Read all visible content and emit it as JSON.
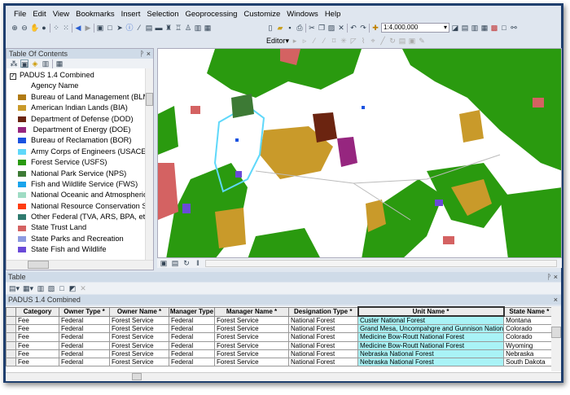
{
  "menu": [
    "File",
    "Edit",
    "View",
    "Bookmarks",
    "Insert",
    "Selection",
    "Geoprocessing",
    "Customize",
    "Windows",
    "Help"
  ],
  "toolbar": {
    "scale": "1:4,000,000",
    "editor": "Editor▾"
  },
  "toc": {
    "title": "Table Of Contents",
    "layer": "PADUS 1.4 Combined",
    "field": "Agency Name",
    "items": [
      {
        "label": "Bureau of Land Management (BLM)",
        "color": "#b07a14"
      },
      {
        "label": "American Indian Lands (BIA)",
        "color": "#c99a2a"
      },
      {
        "label": "Department of Defense (DOD)",
        "color": "#6b2410"
      },
      {
        "label": " Department of Energy (DOE)",
        "color": "#96267f"
      },
      {
        "label": "Bureau of Reclamation (BOR)",
        "color": "#1a52e0"
      },
      {
        "label": "Army Corps of Engineers (USACE)",
        "color": "#5fd8fa"
      },
      {
        "label": "Forest Service (USFS)",
        "color": "#2a9a0f"
      },
      {
        "label": "National Park Service (NPS)",
        "color": "#3d7a35"
      },
      {
        "label": "Fish and Wildlife Service (FWS)",
        "color": "#1aa4ec"
      },
      {
        "label": "National Oceanic and Atmospheric Ac",
        "color": "#9fdcc4"
      },
      {
        "label": "National Resource Conservation Servic",
        "color": "#ff3c0f"
      },
      {
        "label": "Other Federal (TVA, ARS, BPA, etc.)",
        "color": "#2f7a6e"
      },
      {
        "label": "State Trust Land",
        "color": "#d46262"
      },
      {
        "label": "State Parks and Recreation",
        "color": "#8c9ae0"
      },
      {
        "label": "State Fish and Wildlife",
        "color": "#6a4ad8"
      }
    ]
  },
  "table": {
    "panel_title": "Table",
    "title": "PADUS 1.4 Combined",
    "columns": [
      "Category",
      "Owner Type *",
      "Owner Name *",
      "Manager Type",
      "Manager Name *",
      "Designation Type *",
      "Unit Name *",
      "State Name *"
    ],
    "rows": [
      [
        "Fee",
        "Federal",
        "Forest Service",
        "Federal",
        "Forest Service",
        "National Forest",
        "Custer National Forest",
        "Montana"
      ],
      [
        "Fee",
        "Federal",
        "Forest Service",
        "Federal",
        "Forest Service",
        "National Forest",
        "Grand Mesa, Uncompahgre and Gunnison Nation",
        "Colorado"
      ],
      [
        "Fee",
        "Federal",
        "Forest Service",
        "Federal",
        "Forest Service",
        "National Forest",
        "Medicine Bow-Routt National Forest",
        "Colorado"
      ],
      [
        "Fee",
        "Federal",
        "Forest Service",
        "Federal",
        "Forest Service",
        "National Forest",
        "Medicine Bow-Routt National Forest",
        "Wyoming"
      ],
      [
        "Fee",
        "Federal",
        "Forest Service",
        "Federal",
        "Forest Service",
        "National Forest",
        "Nebraska National Forest",
        "Nebraska"
      ],
      [
        "Fee",
        "Federal",
        "Forest Service",
        "Federal",
        "Forest Service",
        "National Forest",
        "Nebraska National Forest",
        "South Dakota"
      ]
    ]
  }
}
